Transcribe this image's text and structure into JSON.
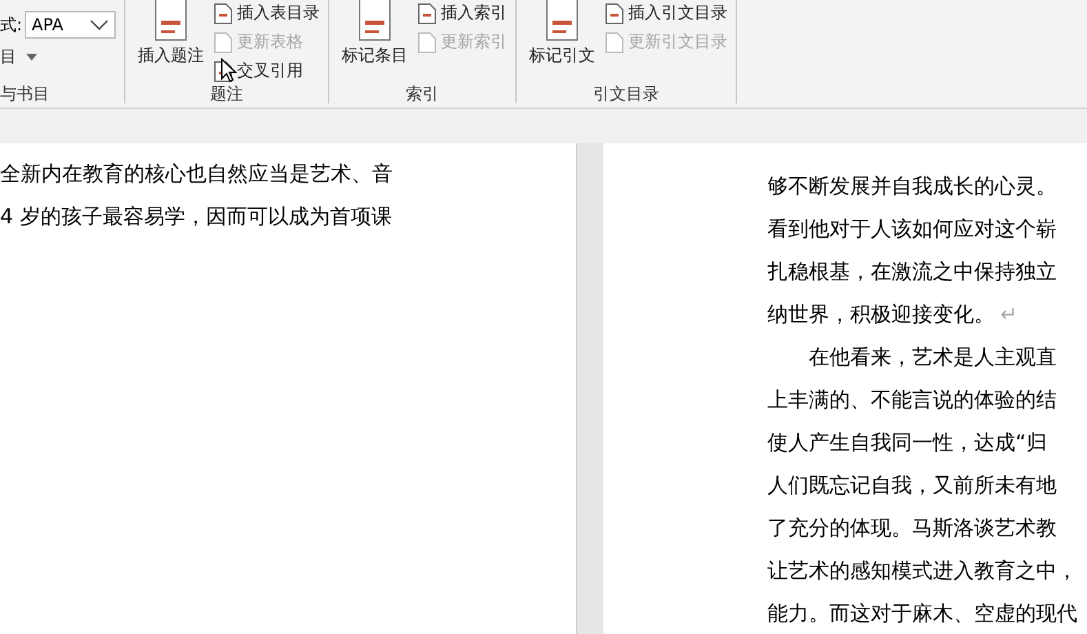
{
  "ribbon": {
    "groups": [
      {
        "kind": "citations",
        "label": "与书目",
        "style_label": "式:",
        "style_value": "APA",
        "bibliography_button": "目"
      },
      {
        "kind": "commands",
        "label": "题注",
        "big_buttons": [
          {
            "label": "插入题注"
          }
        ],
        "small_buttons": [
          {
            "label": "插入表目录",
            "disabled": false
          },
          {
            "label": "更新表格",
            "disabled": true
          },
          {
            "label": "交叉引用",
            "disabled": false
          }
        ]
      },
      {
        "kind": "commands",
        "label": "索引",
        "big_buttons": [
          {
            "label": "标记条目"
          }
        ],
        "small_buttons": [
          {
            "label": "插入索引",
            "disabled": false
          },
          {
            "label": "更新索引",
            "disabled": true
          }
        ]
      },
      {
        "kind": "commands",
        "label": "引文目录",
        "big_buttons": [
          {
            "label": "标记引文"
          }
        ],
        "small_buttons": [
          {
            "label": "插入引文目录",
            "disabled": false
          },
          {
            "label": "更新引文目录",
            "disabled": true
          }
        ]
      }
    ]
  },
  "document": {
    "left_page": [
      {
        "text": "全新内在教育的核心也自然应当是艺术、音",
        "indent": false
      },
      {
        "text": "4 岁的孩子最容易学，因而可以成为首项课",
        "indent": false
      }
    ],
    "right_page": [
      {
        "text": "够不断发展并自我成长的心灵。",
        "indent": false
      },
      {
        "text": "看到他对于人该如何应对这个崭",
        "indent": false
      },
      {
        "text": "扎稳根基，在激流之中保持独立",
        "indent": false
      },
      {
        "text": "纳世界，积极迎接变化。",
        "indent": false,
        "mark": "↵"
      },
      {
        "text": "在他看来，艺术是人主观直",
        "indent": true
      },
      {
        "text": "上丰满的、不能言说的体验的结",
        "indent": false
      },
      {
        "text": "使人产生自我同一性，达成“归",
        "indent": false
      },
      {
        "text": "人们既忘记自我，又前所未有地",
        "indent": false
      },
      {
        "text": "了充分的体现。马斯洛谈艺术教",
        "indent": false
      },
      {
        "text": "让艺术的感知模式进入教育之中，",
        "indent": false
      },
      {
        "text": "能力。而这对于麻木、空虚的现代",
        "indent": false
      }
    ]
  }
}
